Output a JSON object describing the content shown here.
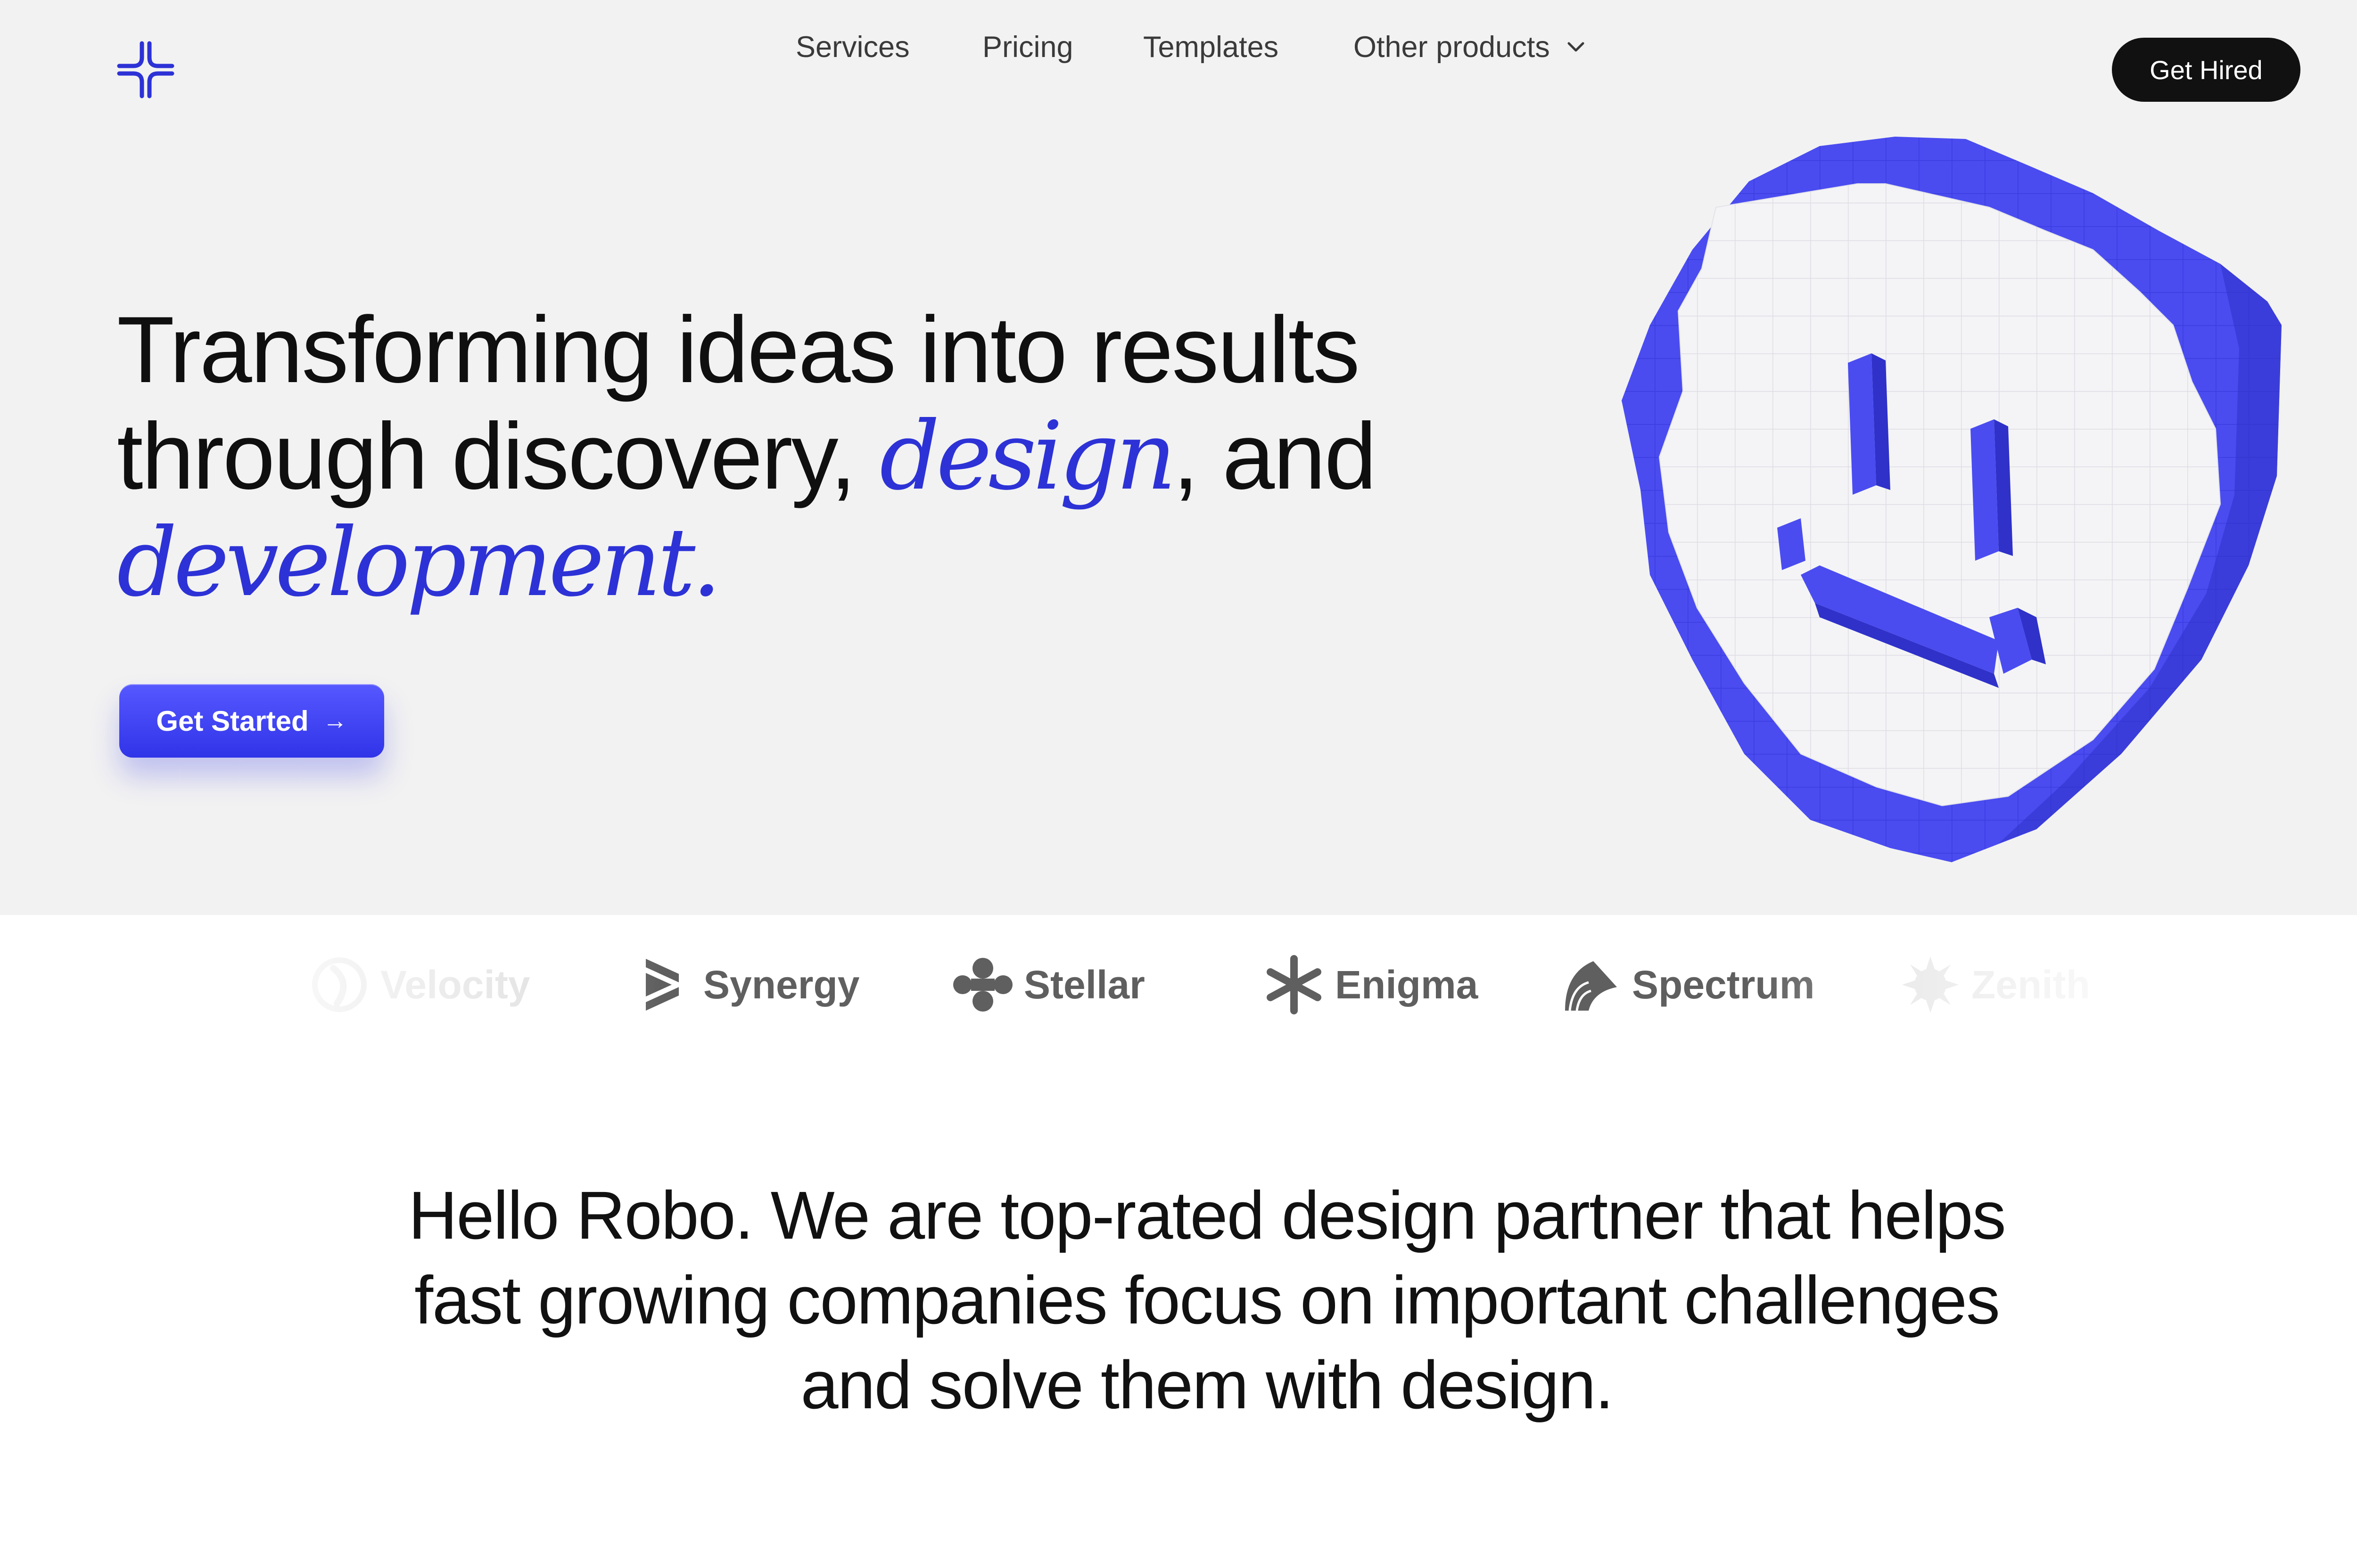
{
  "nav": {
    "logo_icon": "sparkle-cross-icon",
    "links": [
      "Services",
      "Pricing",
      "Templates",
      "Other products"
    ],
    "dropdown_icon": "chevron-down-icon",
    "get_hired": "Get Hired"
  },
  "hero": {
    "headline_part1": "Transforming ideas into results through discovery, ",
    "headline_accent1": "design",
    "headline_part2": ", and ",
    "headline_accent2": "development.",
    "cta_label": "Get Started",
    "cta_icon": "arrow-right-icon",
    "illustration": "pixel-smiley-face-3d"
  },
  "logos": [
    {
      "name": "Velocity",
      "icon": "velocity-logo-icon"
    },
    {
      "name": "Synergy",
      "icon": "synergy-logo-icon"
    },
    {
      "name": "Stellar",
      "icon": "stellar-logo-icon"
    },
    {
      "name": "Enigma",
      "icon": "enigma-logo-icon"
    },
    {
      "name": "Spectrum",
      "icon": "spectrum-logo-icon"
    },
    {
      "name": "Zenith",
      "icon": "zenith-logo-icon"
    }
  ],
  "intro": {
    "text": "Hello Robo. We are top-rated design partner that helps fast growing companies focus on important challenges and solve them with design."
  },
  "colors": {
    "accent": "#2d32d6",
    "hero_bg": "#f2f2f2",
    "cta_bg": "#4346f0",
    "dark_button": "#111111",
    "mascot_blue": "#4a4cf0"
  }
}
